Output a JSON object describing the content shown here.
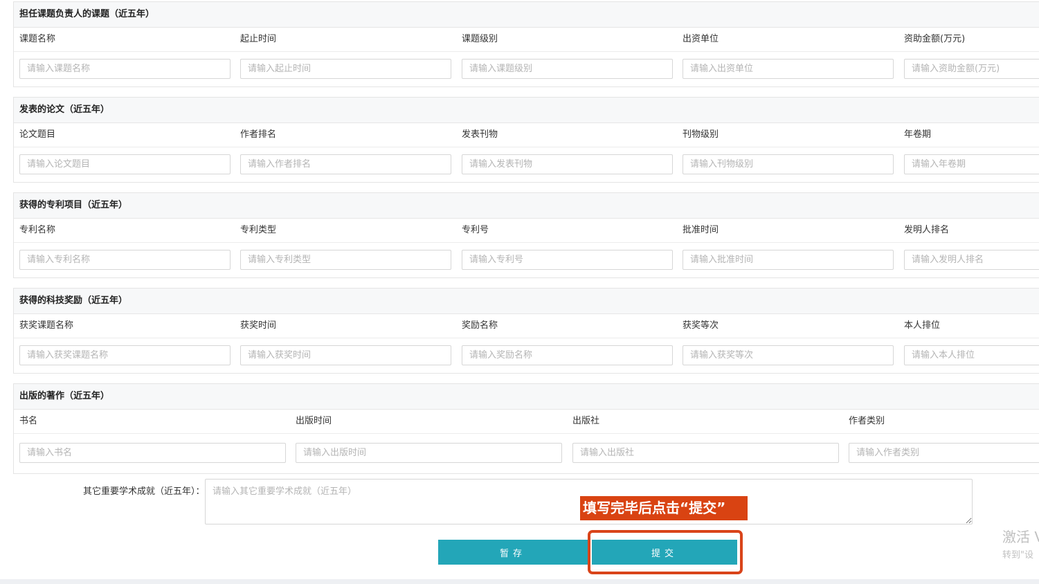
{
  "sections": [
    {
      "title": "担任课题负责人的课题（近五年）",
      "fields": [
        {
          "label": "课题名称",
          "placeholder": "请输入课题名称"
        },
        {
          "label": "起止时间",
          "placeholder": "请输入起止时间"
        },
        {
          "label": "课题级别",
          "placeholder": "请输入课题级别"
        },
        {
          "label": "出资单位",
          "placeholder": "请输入出资单位"
        },
        {
          "label": "资助金额(万元)",
          "placeholder": "请输入资助金额(万元)"
        }
      ]
    },
    {
      "title": "发表的论文（近五年）",
      "fields": [
        {
          "label": "论文题目",
          "placeholder": "请输入论文题目"
        },
        {
          "label": "作者排名",
          "placeholder": "请输入作者排名"
        },
        {
          "label": "发表刊物",
          "placeholder": "请输入发表刊物"
        },
        {
          "label": "刊物级别",
          "placeholder": "请输入刊物级别"
        },
        {
          "label": "年卷期",
          "placeholder": "请输入年卷期"
        }
      ]
    },
    {
      "title": "获得的专利项目（近五年）",
      "fields": [
        {
          "label": "专利名称",
          "placeholder": "请输入专利名称"
        },
        {
          "label": "专利类型",
          "placeholder": "请输入专利类型"
        },
        {
          "label": "专利号",
          "placeholder": "请输入专利号"
        },
        {
          "label": "批准时间",
          "placeholder": "请输入批准时间"
        },
        {
          "label": "发明人排名",
          "placeholder": "请输入发明人排名"
        }
      ]
    },
    {
      "title": "获得的科技奖励（近五年）",
      "fields": [
        {
          "label": "获奖课题名称",
          "placeholder": "请输入获奖课题名称"
        },
        {
          "label": "获奖时间",
          "placeholder": "请输入获奖时间"
        },
        {
          "label": "奖励名称",
          "placeholder": "请输入奖励名称"
        },
        {
          "label": "获奖等次",
          "placeholder": "请输入获奖等次"
        },
        {
          "label": "本人排位",
          "placeholder": "请输入本人排位"
        }
      ]
    },
    {
      "title": "出版的著作（近五年）",
      "fields": [
        {
          "label": "书名",
          "placeholder": "请输入书名"
        },
        {
          "label": "出版时间",
          "placeholder": "请输入出版时间"
        },
        {
          "label": "出版社",
          "placeholder": "请输入出版社"
        },
        {
          "label": "作者类别",
          "placeholder": "请输入作者类别"
        }
      ]
    }
  ],
  "other": {
    "label": "其它重要学术成就（近五年）：",
    "placeholder": "请输入其它重要学术成就（近五年）"
  },
  "annotation": "填写完毕后点击“提交”",
  "buttons": {
    "save": "暂存",
    "submit": "提交"
  },
  "watermark": {
    "line1": "激活 V",
    "line2": "转到\"设"
  },
  "colors": {
    "button": "#23a6b8",
    "annotation": "#d94312",
    "highlight": "#d9441a"
  }
}
